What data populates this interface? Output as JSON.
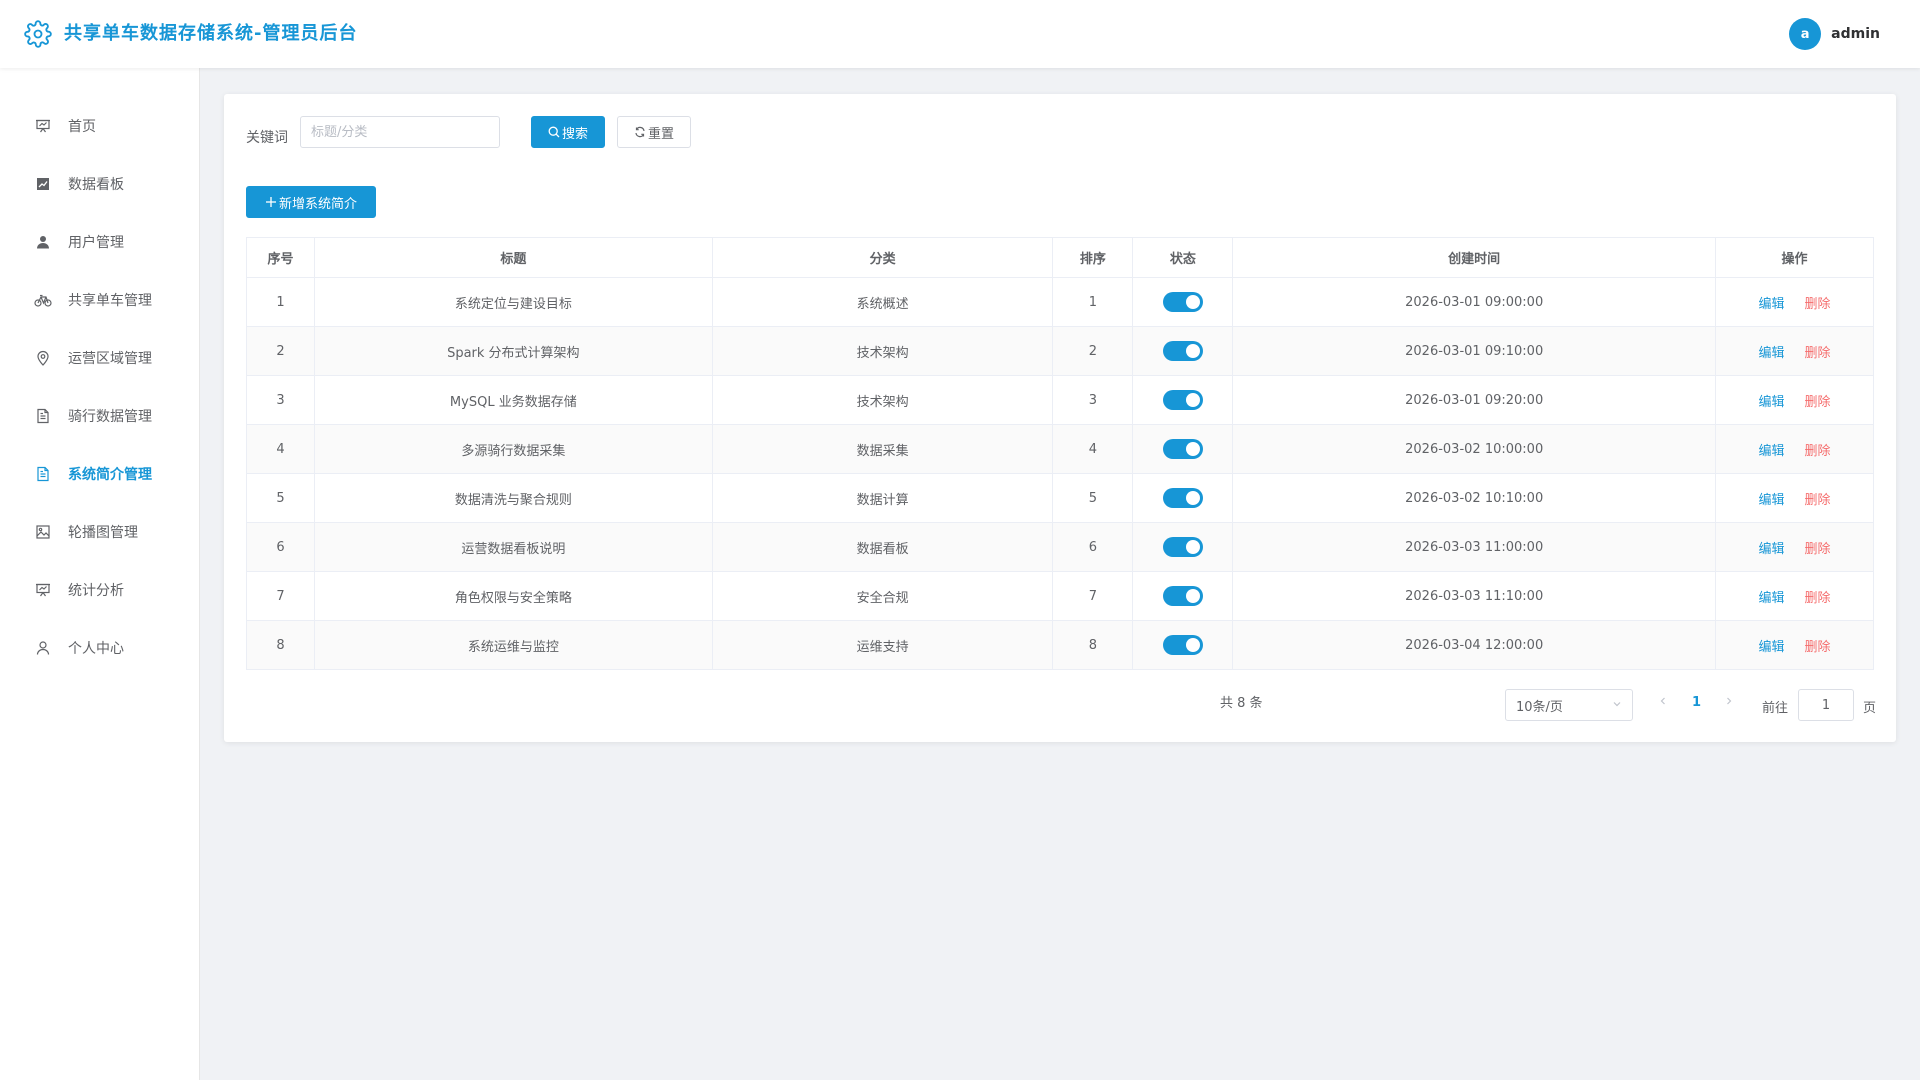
{
  "header": {
    "title": "共享单车数据存储系统-管理员后台",
    "user_avatar_letter": "a",
    "username": "admin"
  },
  "sidebar": {
    "items": [
      {
        "label": "首页",
        "icon": "presentation-icon"
      },
      {
        "label": "数据看板",
        "icon": "chart-icon"
      },
      {
        "label": "用户管理",
        "icon": "user-icon"
      },
      {
        "label": "共享单车管理",
        "icon": "bicycle-icon"
      },
      {
        "label": "运营区域管理",
        "icon": "location-icon"
      },
      {
        "label": "骑行数据管理",
        "icon": "document-icon"
      },
      {
        "label": "系统简介管理",
        "icon": "document-icon"
      },
      {
        "label": "轮播图管理",
        "icon": "picture-icon"
      },
      {
        "label": "统计分析",
        "icon": "presentation-icon"
      },
      {
        "label": "个人中心",
        "icon": "person-icon"
      }
    ],
    "active_index": 6
  },
  "search": {
    "label": "关键词",
    "placeholder": "标题/分类",
    "value": "",
    "search_button": "搜索",
    "reset_button": "重置"
  },
  "add_button": "新增系统简介",
  "table": {
    "columns": [
      "序号",
      "标题",
      "分类",
      "排序",
      "状态",
      "创建时间",
      "操作"
    ],
    "rows": [
      {
        "index": "1",
        "title": "系统定位与建设目标",
        "category": "系统概述",
        "sort": "1",
        "status": true,
        "created": "2026-03-01 09:00:00"
      },
      {
        "index": "2",
        "title": "Spark 分布式计算架构",
        "category": "技术架构",
        "sort": "2",
        "status": true,
        "created": "2026-03-01 09:10:00"
      },
      {
        "index": "3",
        "title": "MySQL 业务数据存储",
        "category": "技术架构",
        "sort": "3",
        "status": true,
        "created": "2026-03-01 09:20:00"
      },
      {
        "index": "4",
        "title": "多源骑行数据采集",
        "category": "数据采集",
        "sort": "4",
        "status": true,
        "created": "2026-03-02 10:00:00"
      },
      {
        "index": "5",
        "title": "数据清洗与聚合规则",
        "category": "数据计算",
        "sort": "5",
        "status": true,
        "created": "2026-03-02 10:10:00"
      },
      {
        "index": "6",
        "title": "运营数据看板说明",
        "category": "数据看板",
        "sort": "6",
        "status": true,
        "created": "2026-03-03 11:00:00"
      },
      {
        "index": "7",
        "title": "角色权限与安全策略",
        "category": "安全合规",
        "sort": "7",
        "status": true,
        "created": "2026-03-03 11:10:00"
      },
      {
        "index": "8",
        "title": "系统运维与监控",
        "category": "运维支持",
        "sort": "8",
        "status": true,
        "created": "2026-03-04 12:00:00"
      }
    ],
    "edit_label": "编辑",
    "delete_label": "删除"
  },
  "pagination": {
    "total_text": "共 8 条",
    "page_size": "10条/页",
    "current_page": "1",
    "goto_label": "前往",
    "goto_value": "1",
    "page_suffix": "页"
  },
  "colors": {
    "accent": "#1796d6",
    "danger": "#f56c6c"
  }
}
